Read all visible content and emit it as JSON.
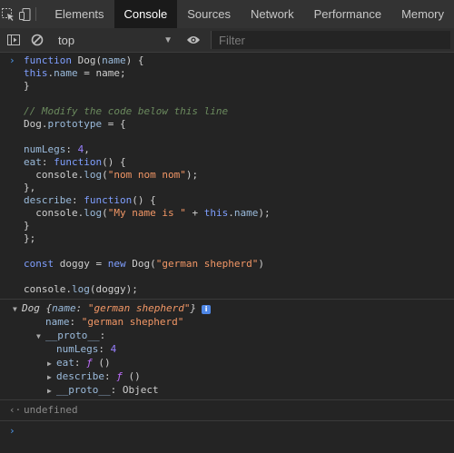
{
  "tabs": [
    "Elements",
    "Console",
    "Sources",
    "Network",
    "Performance",
    "Memory"
  ],
  "active_tab": "Console",
  "toolbar": {
    "context": "top",
    "filter_placeholder": "Filter"
  },
  "code": {
    "l1_kw": "function",
    "l1_name": "Dog",
    "l1_param": "name",
    "l1_rest": ") {",
    "l2_this": "this",
    "l2_prop": "name",
    "l2_rest": " = name;",
    "l3": "}",
    "l5_comment": "// Modify the code below this line",
    "l6_obj": "Dog",
    "l6_prop": "prototype",
    "l6_rest": " = {",
    "l8_key": "numLegs",
    "l8_val": "4",
    "l9_key": "eat",
    "l9_kw": "function",
    "l9_rest": "() {",
    "l10_pre": "  console.",
    "l10_fn": "log",
    "l10_str": "\"nom nom nom\"",
    "l10_rest": ");",
    "l11": "},",
    "l12_key": "describe",
    "l12_kw": "function",
    "l12_rest": "() {",
    "l13_pre": "  console.",
    "l13_fn": "log",
    "l13_str": "\"My name is \"",
    "l13_mid": " + ",
    "l13_this": "this",
    "l13_prop": "name",
    "l13_rest": ");",
    "l14": "}",
    "l15": "};",
    "l17_kw": "const",
    "l17_var": "doggy",
    "l17_new": "new",
    "l17_fn": "Dog",
    "l17_str": "\"german shepherd\"",
    "l19_pre": "console.",
    "l19_fn": "log",
    "l19_arg": "doggy",
    "l19_rest": ");"
  },
  "output": {
    "summary_type": "Dog",
    "summary_key": "name",
    "summary_val": "\"german shepherd\"",
    "name_key": "name",
    "name_val": "\"german shepherd\"",
    "proto_key": "__proto__",
    "numlegs_key": "numLegs",
    "numlegs_val": "4",
    "eat_key": "eat",
    "describe_key": "describe",
    "fsym": "ƒ",
    "fparens": "()",
    "proto2_key": "__proto__",
    "proto2_val": "Object"
  },
  "result": "undefined"
}
